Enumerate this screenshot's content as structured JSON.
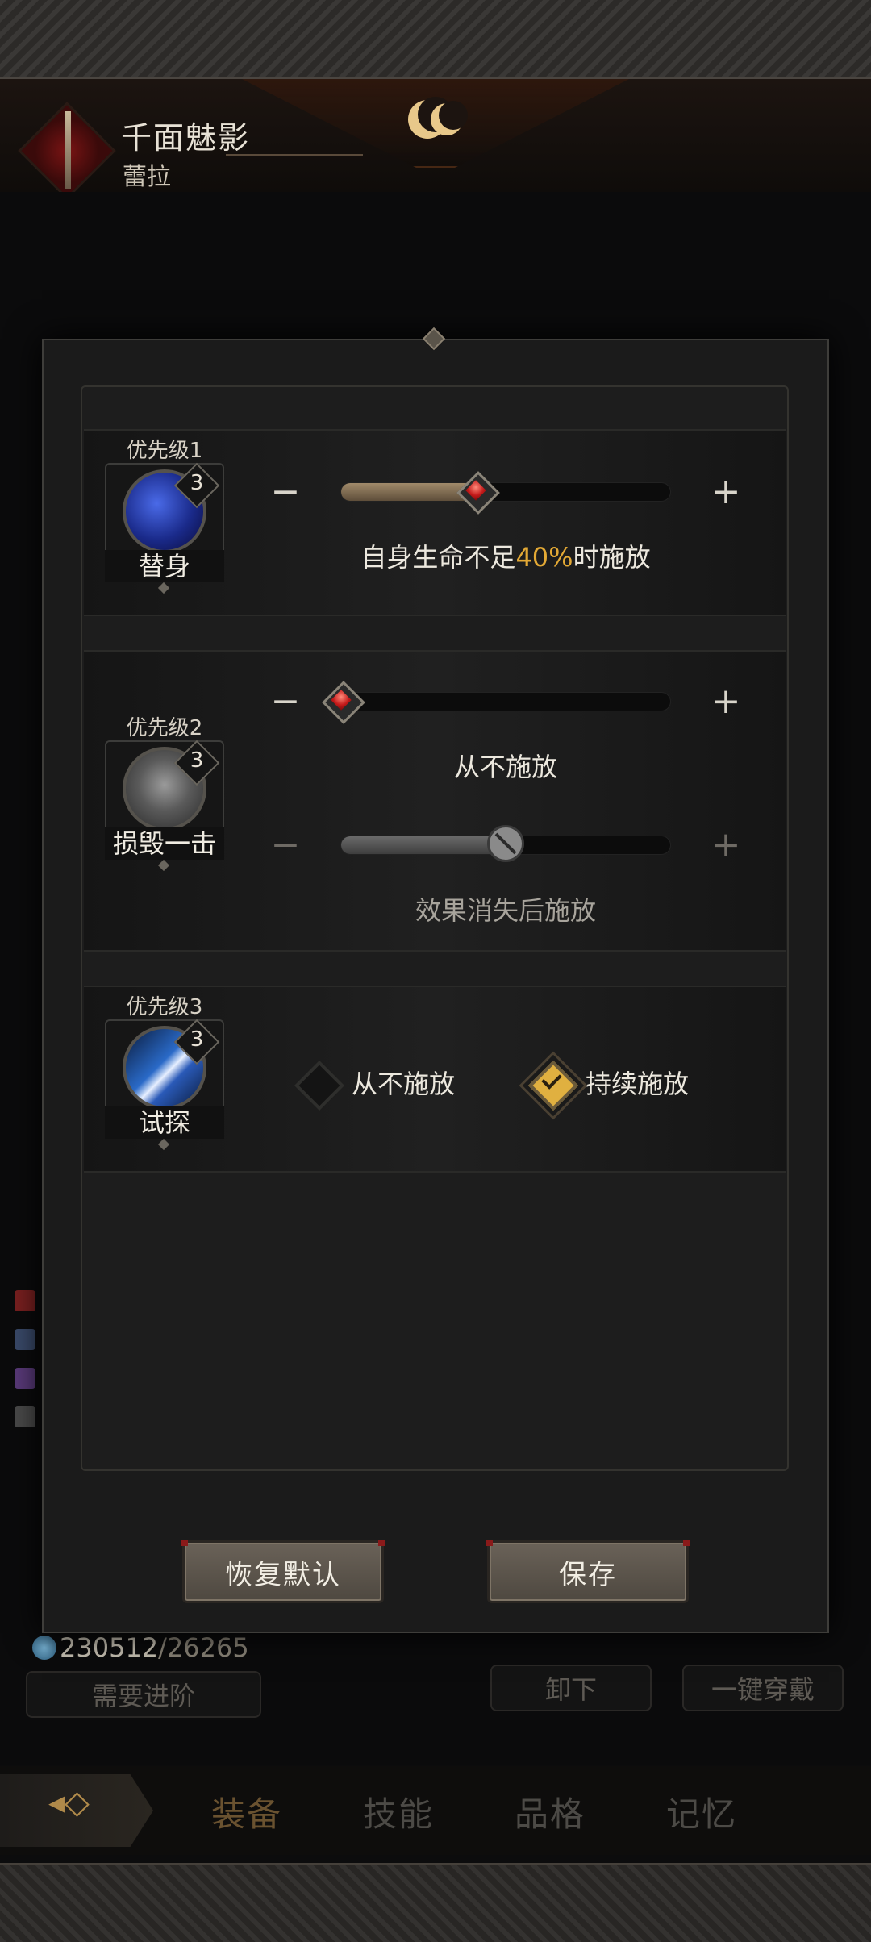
{
  "header": {
    "title": "千面魅影",
    "subtitle": "蕾拉"
  },
  "background": {
    "resource_current": "230512",
    "resource_sep": "/",
    "resource_required": "26265",
    "advance_button": "需要进阶",
    "unequip_button": "卸下",
    "equip_all_button": "一键穿戴",
    "nav_tabs": [
      "装备",
      "技能",
      "品格",
      "记忆"
    ],
    "active_tab": "装备"
  },
  "rows": [
    {
      "priority": "优先级1",
      "skill_name": "替身",
      "skill_level": "3",
      "sliders": [
        {
          "level": 0.41,
          "caption_pre": "自身生命不足",
          "caption_highlight": "40%",
          "caption_post": "时施放",
          "enabled": true
        }
      ]
    },
    {
      "priority": "优先级2",
      "skill_name": "损毁一击",
      "skill_level": "3",
      "sliders": [
        {
          "level": 0.0,
          "caption": "从不施放",
          "enabled": true
        },
        {
          "level": 0.5,
          "caption": "效果消失后施放",
          "enabled": false
        }
      ]
    },
    {
      "priority": "优先级3",
      "skill_name": "试探",
      "skill_level": "3",
      "options": [
        {
          "label": "从不施放",
          "checked": false
        },
        {
          "label": "持续施放",
          "checked": true
        }
      ]
    }
  ],
  "buttons": {
    "reset": "恢复默认",
    "save": "保存"
  },
  "colors": {
    "highlight": "#e3a935",
    "checked": "#e0b040",
    "slider_fill": "#a08a6a",
    "thumb_gem": "#c41a1a"
  },
  "icons": {
    "minus": "−",
    "plus": "+"
  }
}
